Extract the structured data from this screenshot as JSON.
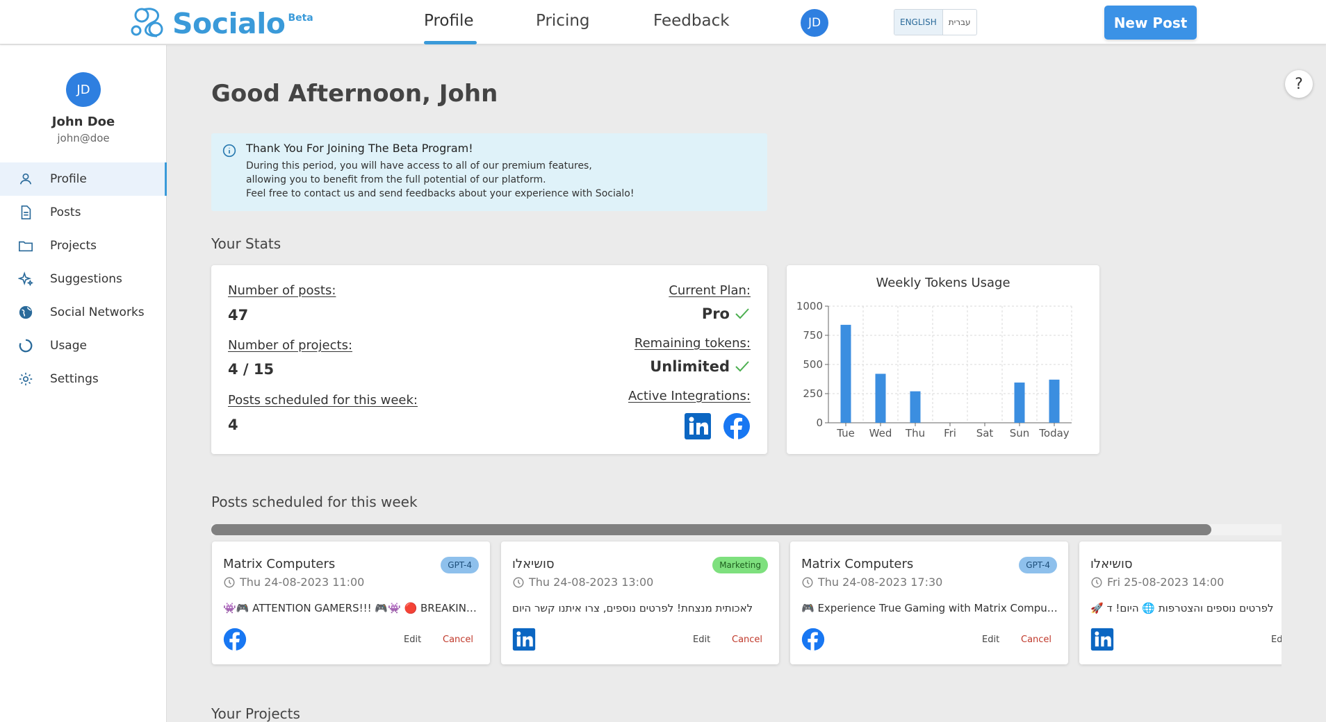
{
  "header": {
    "brand": "Socialo",
    "brand_badge": "Beta",
    "nav": [
      "Profile",
      "Pricing",
      "Feedback"
    ],
    "user_initials": "JD",
    "lang_options": [
      "ENGLISH",
      "עברית"
    ],
    "new_post_label": "New Post"
  },
  "sidebar": {
    "initials": "JD",
    "name": "John Doe",
    "email": "john@doe",
    "items": [
      {
        "label": "Profile",
        "icon": "person-icon"
      },
      {
        "label": "Posts",
        "icon": "document-icon"
      },
      {
        "label": "Projects",
        "icon": "folder-icon"
      },
      {
        "label": "Suggestions",
        "icon": "sparkle-icon"
      },
      {
        "label": "Social Networks",
        "icon": "globe-icon"
      },
      {
        "label": "Usage",
        "icon": "circle-progress-icon"
      },
      {
        "label": "Settings",
        "icon": "gear-icon"
      }
    ]
  },
  "main": {
    "greeting": "Good Afternoon, John",
    "beta": {
      "title": "Thank You For Joining The Beta Program!",
      "lines": [
        "During this period, you will have access to all of our premium features,",
        "allowing you to benefit from the full potential of our platform.",
        "Feel free to contact us and send feedbacks about your experience with Socialo!"
      ]
    },
    "stats_title": "Your Stats",
    "stats": {
      "posts_label": "Number of posts:",
      "posts_value": "47",
      "projects_label": "Number of projects:",
      "projects_value": "4 / 15",
      "scheduled_label": "Posts scheduled for this week:",
      "scheduled_value": "4",
      "plan_label": "Current Plan:",
      "plan_value": "Pro",
      "tokens_label": "Remaining tokens:",
      "tokens_value": "Unlimited",
      "integrations_label": "Active Integrations:"
    },
    "posts_title": "Posts scheduled for this week",
    "posts": [
      {
        "title": "Matrix Computers",
        "badge": "GPT-4",
        "time": "Thu 24-08-2023 11:00",
        "text": "👾🎮 ATTENTION GAMERS!!! 🎮👾 🔴 BREAKING NEWS",
        "network": "facebook",
        "edit": "Edit",
        "cancel": "Cancel"
      },
      {
        "title": "סושיאלו",
        "badge": "Marketing",
        "time": "Thu 24-08-2023 13:00",
        "text": "לאכותית מנצחת! לפרטים נוספים, צרו איתנו קשר היום",
        "network": "linkedin",
        "edit": "Edit",
        "cancel": "Cancel"
      },
      {
        "title": "Matrix Computers",
        "badge": "GPT-4",
        "time": "Thu 24-08-2023 17:30",
        "text": "🎮 Experience True Gaming with Matrix Computers",
        "network": "facebook",
        "edit": "Edit",
        "cancel": "Cancel"
      },
      {
        "title": "סושיאלו",
        "badge": "",
        "time": "Fri 25-08-2023 14:00",
        "text": "🚀 לפרטים נוספים והצטרפות 🌐 היום! ד",
        "network": "linkedin",
        "edit": "Ed",
        "cancel": ""
      }
    ],
    "projects_title": "Your Projects"
  },
  "colors": {
    "accent": "#3a9ad9",
    "primary_button": "#3b92e6",
    "bar": "#3b8ee0",
    "check": "#4caf50",
    "cancel": "#c0392b",
    "badge_gpt": "#8ec0ec",
    "badge_marketing": "#7ee07e"
  },
  "chart_data": {
    "type": "bar",
    "title": "Weekly Tokens Usage",
    "categories": [
      "Tue",
      "Wed",
      "Thu",
      "Fri",
      "Sat",
      "Sun",
      "Today"
    ],
    "values": [
      840,
      420,
      270,
      0,
      0,
      345,
      370
    ],
    "ylim": [
      0,
      1000
    ],
    "yticks": [
      0,
      250,
      500,
      750,
      1000
    ],
    "xlabel": "",
    "ylabel": "",
    "grid": true
  },
  "help_label": "?"
}
